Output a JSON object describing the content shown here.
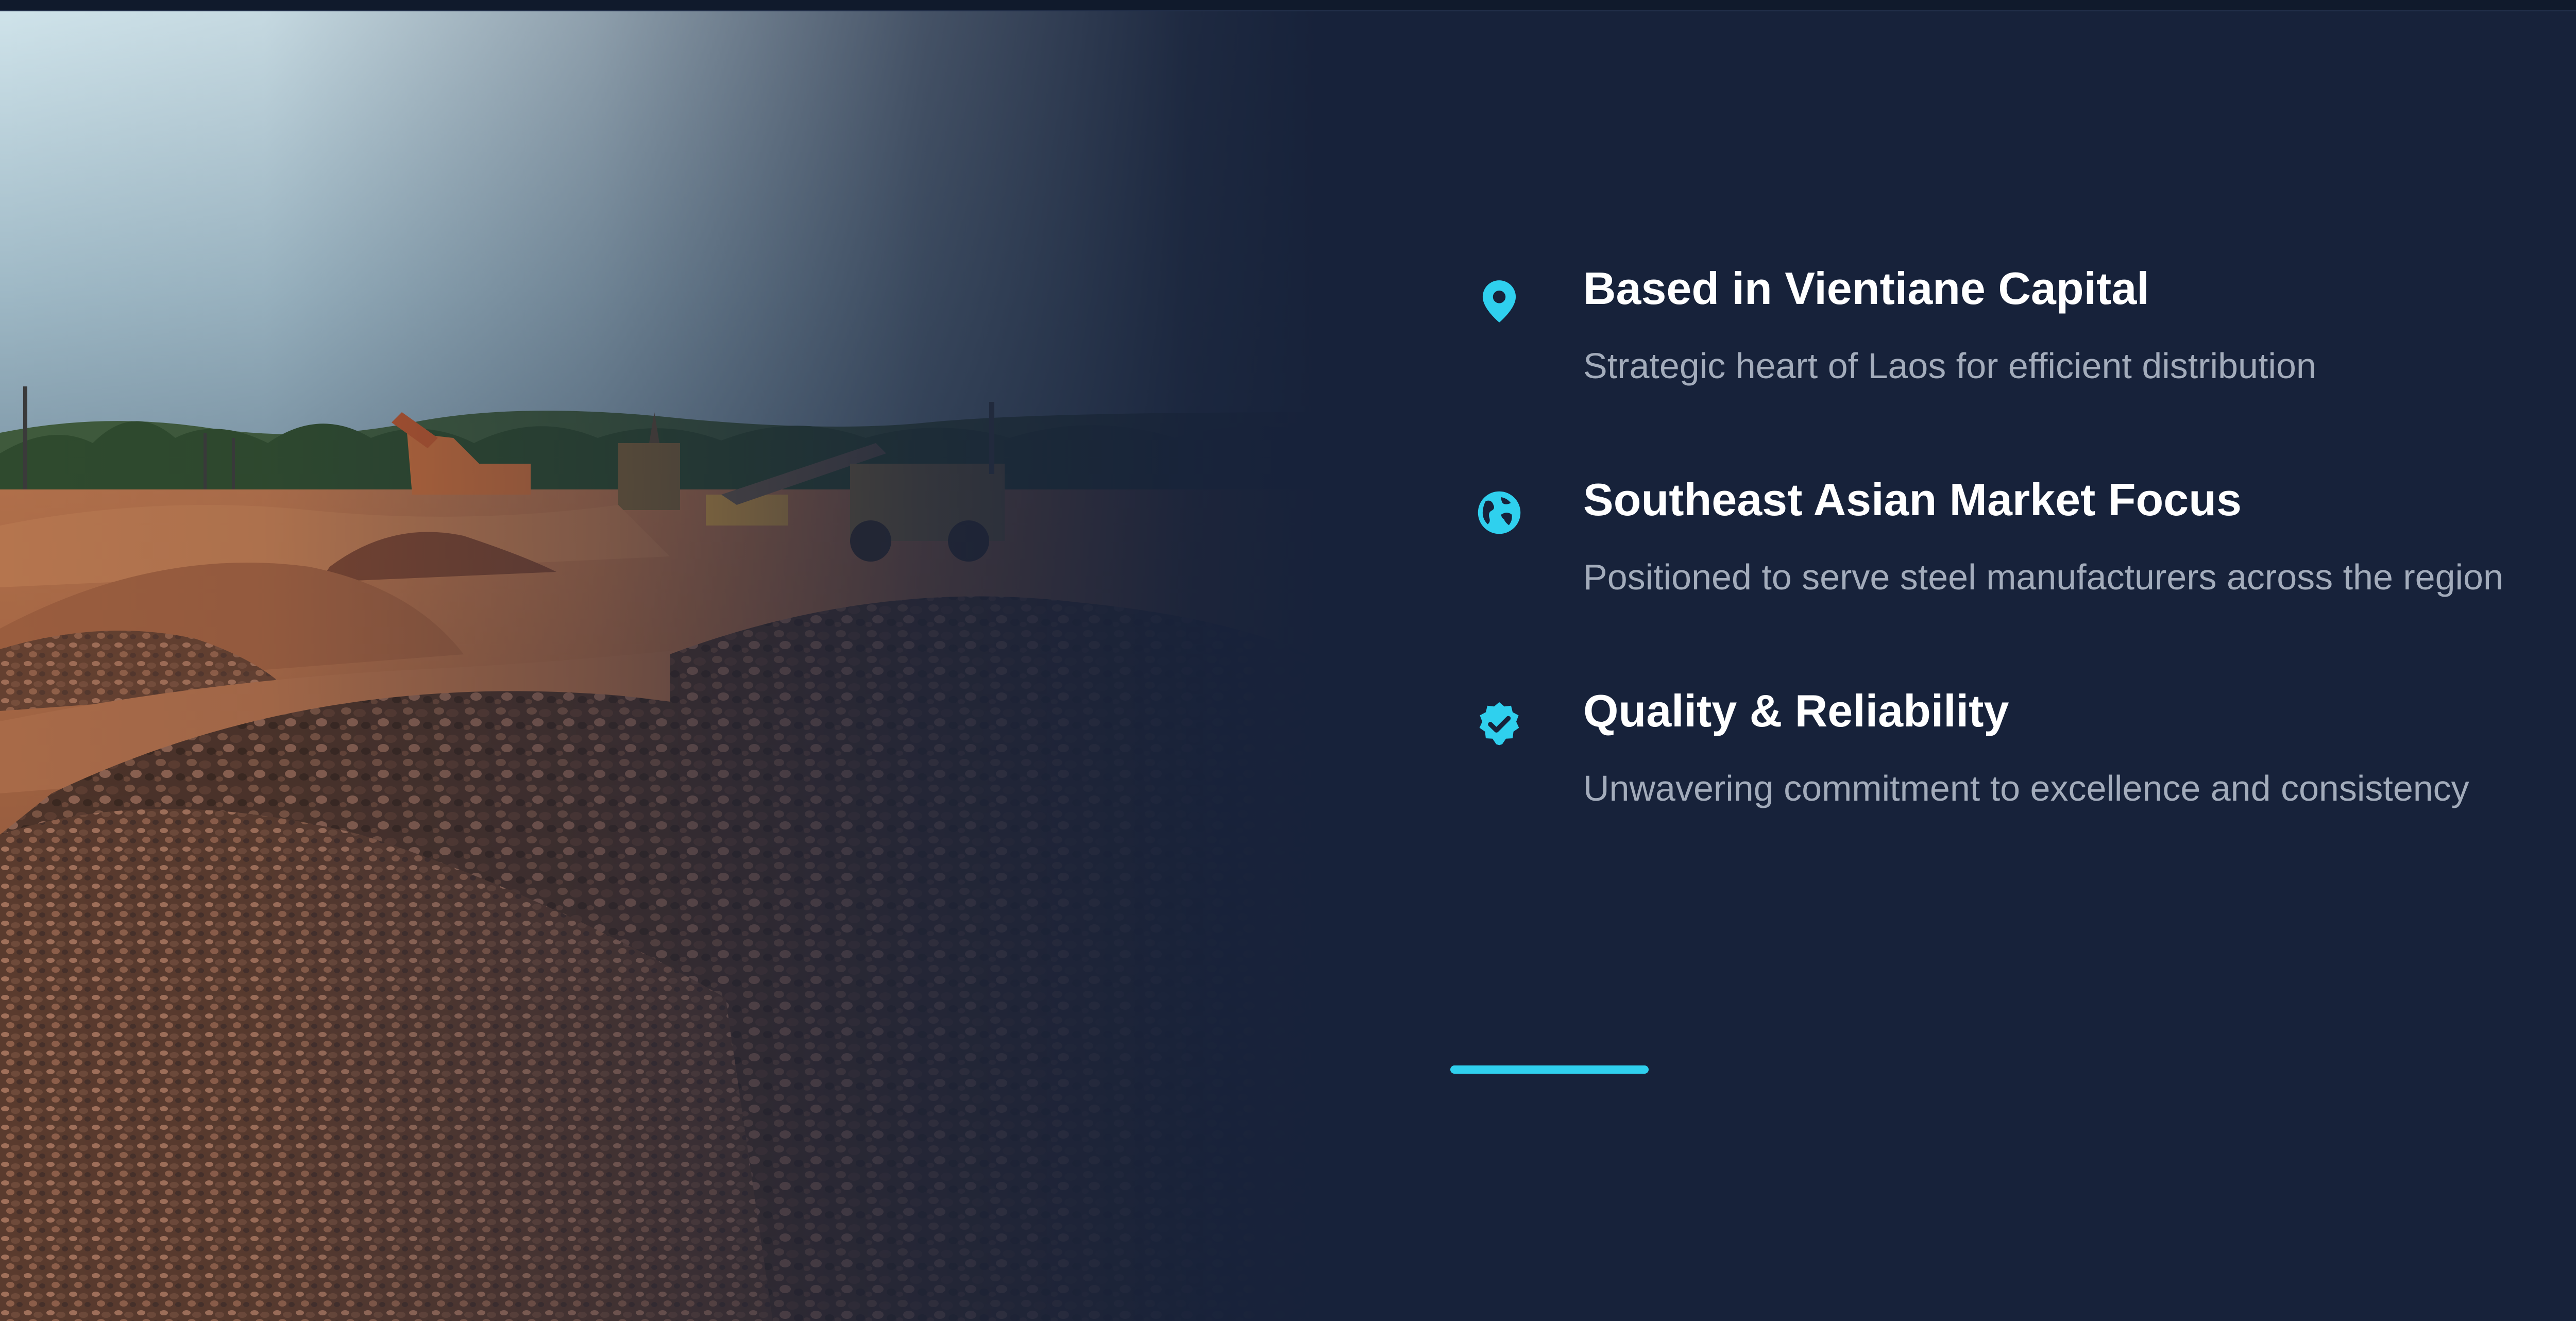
{
  "colors": {
    "background": "#17223a",
    "accent": "#2fd0ee",
    "title": "#ffffff",
    "description": "#a3acbb"
  },
  "features": [
    {
      "icon": "map-pin-icon",
      "title": "Based in Vientiane Capital",
      "description": "Strategic heart of Laos for efficient distribution"
    },
    {
      "icon": "globe-icon",
      "title": "Southeast Asian Market Focus",
      "description": "Positioned to serve steel manufacturers across the region"
    },
    {
      "icon": "verified-badge-icon",
      "title": "Quality & Reliability",
      "description": "Unwavering commitment to excellence and consistency"
    }
  ]
}
